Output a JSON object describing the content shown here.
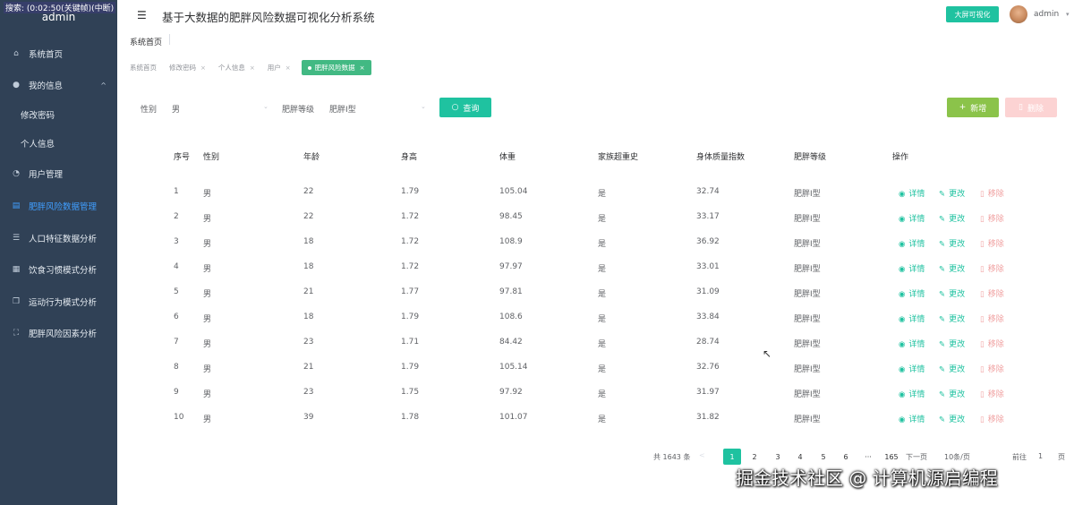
{
  "overlay": "搜索: (0:02:50(关键帧)(中断)",
  "sidebar": {
    "brand": "admin",
    "items": [
      {
        "label": "系统首页",
        "icon": "home-icon"
      },
      {
        "label": "我的信息",
        "icon": "user-icon"
      },
      {
        "label": "修改密码",
        "icon": ""
      },
      {
        "label": "个人信息",
        "icon": ""
      },
      {
        "label": "用户管理",
        "icon": "dashboard-icon"
      },
      {
        "label": "肥胖风险数据管理",
        "icon": "clipboard-icon"
      },
      {
        "label": "人口特征数据分析",
        "icon": "database-icon"
      },
      {
        "label": "饮食习惯模式分析",
        "icon": "calendar-icon"
      },
      {
        "label": "运动行为模式分析",
        "icon": "copy-icon"
      },
      {
        "label": "肥胖风险因素分析",
        "icon": "fullscreen-icon"
      }
    ]
  },
  "header": {
    "title": "基于大数据的肥胖风险数据可视化分析系统",
    "dashboard_button": "大屏可视化",
    "user": "admin"
  },
  "breadcrumb": "系统首页",
  "tags": [
    {
      "label": "系统首页",
      "closable": false
    },
    {
      "label": "修改密码",
      "closable": true
    },
    {
      "label": "个人信息",
      "closable": true
    },
    {
      "label": "用户",
      "closable": true
    },
    {
      "label": "肥胖风险数据",
      "closable": true,
      "active": true
    }
  ],
  "filters": {
    "gender_label": "性别",
    "gender_value": "男",
    "level_label": "肥胖等级",
    "level_value": "肥胖I型",
    "query_button": "查询",
    "add_button": "新增",
    "delete_button": "删除"
  },
  "table": {
    "headers": [
      "序号",
      "性别",
      "年龄",
      "身高",
      "体重",
      "家族超重史",
      "身体质量指数",
      "肥胖等级",
      "操作"
    ],
    "actions": {
      "view": "详情",
      "edit": "更改",
      "remove": "移除"
    },
    "rows": [
      [
        "1",
        "男",
        "22",
        "1.79",
        "105.04",
        "是",
        "32.74",
        "肥胖I型"
      ],
      [
        "2",
        "男",
        "22",
        "1.72",
        "98.45",
        "是",
        "33.17",
        "肥胖I型"
      ],
      [
        "3",
        "男",
        "18",
        "1.72",
        "108.9",
        "是",
        "36.92",
        "肥胖I型"
      ],
      [
        "4",
        "男",
        "18",
        "1.72",
        "97.97",
        "是",
        "33.01",
        "肥胖I型"
      ],
      [
        "5",
        "男",
        "21",
        "1.77",
        "97.81",
        "是",
        "31.09",
        "肥胖I型"
      ],
      [
        "6",
        "男",
        "18",
        "1.79",
        "108.6",
        "是",
        "33.84",
        "肥胖I型"
      ],
      [
        "7",
        "男",
        "23",
        "1.71",
        "84.42",
        "是",
        "28.74",
        "肥胖I型"
      ],
      [
        "8",
        "男",
        "21",
        "1.79",
        "105.14",
        "是",
        "32.76",
        "肥胖I型"
      ],
      [
        "9",
        "男",
        "23",
        "1.75",
        "97.92",
        "是",
        "31.97",
        "肥胖I型"
      ],
      [
        "10",
        "男",
        "39",
        "1.78",
        "101.07",
        "是",
        "31.82",
        "肥胖I型"
      ]
    ]
  },
  "pagination": {
    "total": "共 1643 条",
    "prev": "<",
    "pages": [
      "1",
      "2",
      "3",
      "4",
      "5",
      "6",
      "···",
      "165"
    ],
    "current": "1",
    "next": "下一页",
    "page_size": "10条/页",
    "goto": "前往",
    "goto_value": "1",
    "goto_unit": "页"
  },
  "watermark": "掘金技术社区 @ 计算机源启编程"
}
